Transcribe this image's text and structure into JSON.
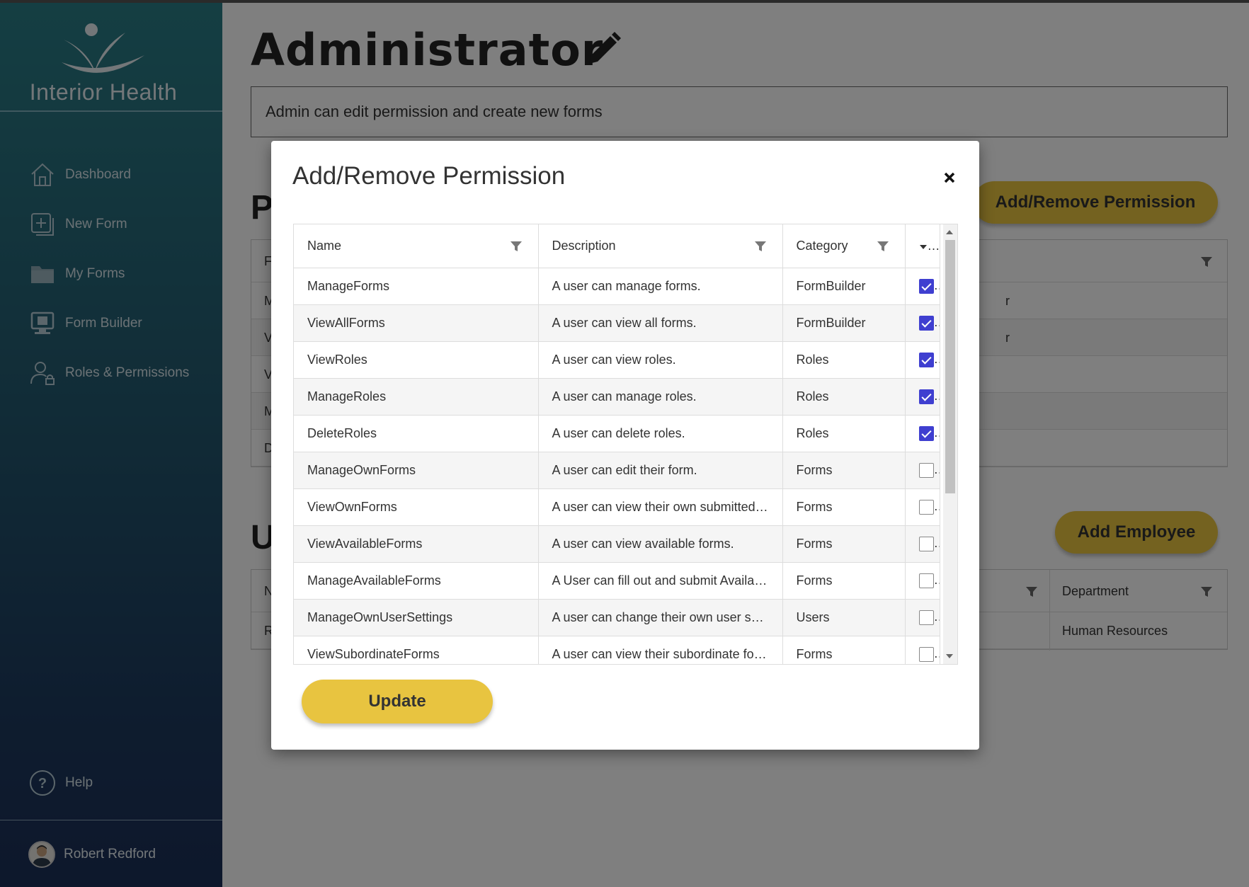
{
  "sidebar": {
    "logo_text": "Interior Health",
    "items": [
      {
        "label": "Dashboard",
        "icon": "home-icon"
      },
      {
        "label": "New Form",
        "icon": "add-form-icon"
      },
      {
        "label": "My Forms",
        "icon": "folder-icon"
      },
      {
        "label": "Form Builder",
        "icon": "monitor-icon"
      },
      {
        "label": "Roles & Permissions",
        "icon": "user-lock-icon"
      }
    ],
    "help_label": "Help",
    "user_name": "Robert Redford"
  },
  "page": {
    "title": "Administrator",
    "description": "Admin can edit permission and create new forms",
    "permissions_section_letter": "P",
    "users_section_letter": "U",
    "add_remove_permission_label": "Add/Remove Permission",
    "add_employee_label": "Add Employee",
    "bg_permissions_first_col": [
      "F",
      "M",
      "V",
      "V",
      "M",
      "D"
    ],
    "bg_permissions_right_col": [
      "r",
      "r"
    ],
    "bg_users_header_first": "N",
    "bg_users_header_department": "Department",
    "bg_users_row_first": "R",
    "bg_users_row_department": "Human Resources"
  },
  "modal": {
    "title": "Add/Remove Permission",
    "columns": [
      "Name",
      "Description",
      "Category"
    ],
    "rows": [
      {
        "name": "ManageForms",
        "description": "A user can manage forms.",
        "category": "FormBuilder",
        "checked": true
      },
      {
        "name": "ViewAllForms",
        "description": "A user can view all forms.",
        "category": "FormBuilder",
        "checked": true
      },
      {
        "name": "ViewRoles",
        "description": "A user can view roles.",
        "category": "Roles",
        "checked": true
      },
      {
        "name": "ManageRoles",
        "description": "A user can manage roles.",
        "category": "Roles",
        "checked": true
      },
      {
        "name": "DeleteRoles",
        "description": "A user can delete roles.",
        "category": "Roles",
        "checked": true
      },
      {
        "name": "ManageOwnForms",
        "description": "A user can edit their form.",
        "category": "Forms",
        "checked": false
      },
      {
        "name": "ViewOwnForms",
        "description": "A user can view their own submitted …",
        "category": "Forms",
        "checked": false
      },
      {
        "name": "ViewAvailableForms",
        "description": "A user can view available forms.",
        "category": "Forms",
        "checked": false
      },
      {
        "name": "ManageAvailableForms",
        "description": "A User can fill out and submit Availa…",
        "category": "Forms",
        "checked": false
      },
      {
        "name": "ManageOwnUserSettings",
        "description": "A user can change their own user se…",
        "category": "Users",
        "checked": false
      },
      {
        "name": "ViewSubordinateForms",
        "description": "A user can view their subordinate for…",
        "category": "Forms",
        "checked": false
      }
    ],
    "update_label": "Update"
  },
  "colors": {
    "accent_yellow": "#e8c440",
    "checkbox_blue": "#3f3fd0",
    "sidebar_top": "#2a7d86",
    "sidebar_bottom": "#1b2f58"
  }
}
